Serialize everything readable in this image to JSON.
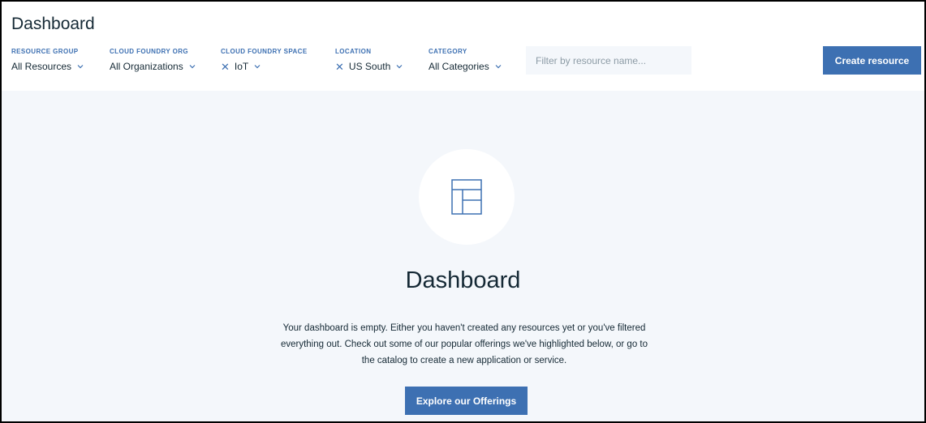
{
  "header": {
    "title": "Dashboard"
  },
  "filters": [
    {
      "label": "RESOURCE GROUP",
      "value": "All Resources",
      "removable": false
    },
    {
      "label": "CLOUD FOUNDRY ORG",
      "value": "All Organizations",
      "removable": false
    },
    {
      "label": "CLOUD FOUNDRY SPACE",
      "value": "IoT",
      "removable": true
    },
    {
      "label": "LOCATION",
      "value": "US South",
      "removable": true
    },
    {
      "label": "CATEGORY",
      "value": "All Categories",
      "removable": false
    }
  ],
  "icons": {
    "remove": "close-icon",
    "dropdown": "chevron-down-icon",
    "empty_state": "dashboard-layout-icon"
  },
  "search": {
    "placeholder": "Filter by resource name...",
    "value": ""
  },
  "toolbar": {
    "create_label": "Create resource"
  },
  "empty_state": {
    "title": "Dashboard",
    "description": "Your dashboard is empty. Either you haven't created any resources yet or you've filtered everything out. Check out some of our popular offerings we've highlighted below, or go to the catalog to create a new application or service.",
    "cta_label": "Explore our Offerings"
  },
  "colors": {
    "accent": "#3d70b2",
    "text": "#152935",
    "background": "#f4f7fb",
    "surface": "#ffffff"
  }
}
